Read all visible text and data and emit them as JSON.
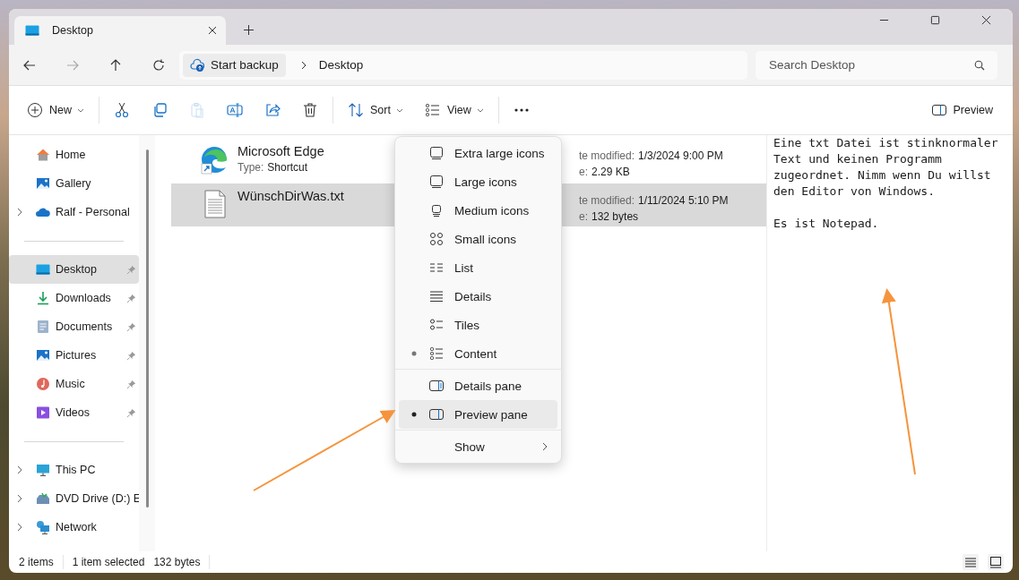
{
  "tabs": [
    {
      "title": "Desktop",
      "selected": true
    }
  ],
  "address": {
    "backup_label": "Start backup",
    "path": [
      "Desktop"
    ]
  },
  "search": {
    "placeholder": "Search Desktop"
  },
  "toolbar": [
    {
      "kind": "new",
      "label": "New",
      "disabled": false
    },
    {
      "kind": "cut",
      "disabled": false
    },
    {
      "kind": "copy",
      "disabled": false
    },
    {
      "kind": "paste",
      "disabled": true
    },
    {
      "kind": "rename",
      "disabled": false
    },
    {
      "kind": "share",
      "disabled": false
    },
    {
      "kind": "delete",
      "disabled": false
    },
    {
      "kind": "sort",
      "label": "Sort",
      "disabled": false
    },
    {
      "kind": "view",
      "label": "View",
      "disabled": false
    },
    {
      "kind": "more",
      "disabled": false
    }
  ],
  "preview_button": {
    "label": "Preview"
  },
  "sidebar": {
    "groups": [
      [
        {
          "label": "Home",
          "expandable": false,
          "pinned": false,
          "selected": false
        },
        {
          "label": "Gallery",
          "expandable": false,
          "pinned": false,
          "selected": false
        },
        {
          "label": "Ralf - Personal",
          "expandable": true,
          "pinned": false,
          "selected": false
        }
      ],
      [
        {
          "label": "Desktop",
          "expandable": false,
          "pinned": true,
          "selected": true
        },
        {
          "label": "Downloads",
          "expandable": false,
          "pinned": true,
          "selected": false
        },
        {
          "label": "Documents",
          "expandable": false,
          "pinned": true,
          "selected": false
        },
        {
          "label": "Pictures",
          "expandable": false,
          "pinned": true,
          "selected": false
        },
        {
          "label": "Music",
          "expandable": false,
          "pinned": true,
          "selected": false
        },
        {
          "label": "Videos",
          "expandable": false,
          "pinned": true,
          "selected": false
        }
      ],
      [
        {
          "label": "This PC",
          "expandable": true,
          "pinned": false,
          "selected": false
        },
        {
          "label": "DVD Drive (D:) E",
          "expandable": true,
          "pinned": false,
          "selected": false
        },
        {
          "label": "Network",
          "expandable": true,
          "pinned": false,
          "selected": false
        }
      ]
    ]
  },
  "files": [
    {
      "name": "Microsoft Edge",
      "type_label": "Type:",
      "type": "Shortcut",
      "date_label": "te modified:",
      "date": "1/3/2024 9:00 PM",
      "size_label": "e:",
      "size": "2.29 KB",
      "selected": false
    },
    {
      "name": "WünschDirWas.txt",
      "date_label": "te modified:",
      "date": "1/11/2024 5:10 PM",
      "size_label": "e:",
      "size": "132 bytes",
      "selected": true
    }
  ],
  "view_menu": {
    "groups": [
      [
        {
          "label": "Extra large icons",
          "selected": false,
          "hovered": false
        },
        {
          "label": "Large icons",
          "selected": false,
          "hovered": false
        },
        {
          "label": "Medium icons",
          "selected": false,
          "hovered": false
        },
        {
          "label": "Small icons",
          "selected": false,
          "hovered": false
        },
        {
          "label": "List",
          "selected": false,
          "hovered": false
        },
        {
          "label": "Details",
          "selected": false,
          "hovered": false
        },
        {
          "label": "Tiles",
          "selected": false,
          "hovered": false
        },
        {
          "label": "Content",
          "selected": true,
          "hovered": false
        }
      ],
      [
        {
          "label": "Details pane",
          "selected": false,
          "hovered": false
        },
        {
          "label": "Preview pane",
          "selected": true,
          "hovered": true
        }
      ],
      [
        {
          "label": "Show",
          "selected": false,
          "hovered": false,
          "submenu": true
        }
      ]
    ]
  },
  "preview": {
    "paragraphs": [
      "Eine txt Datei ist stinknormaler Text und keinen Programm zugeordnet. Nimm wenn Du willst den Editor von Windows.",
      "Es ist Notepad."
    ]
  },
  "status_bar": {
    "count": "2 items",
    "selection": "1 item selected",
    "size": "132 bytes"
  }
}
